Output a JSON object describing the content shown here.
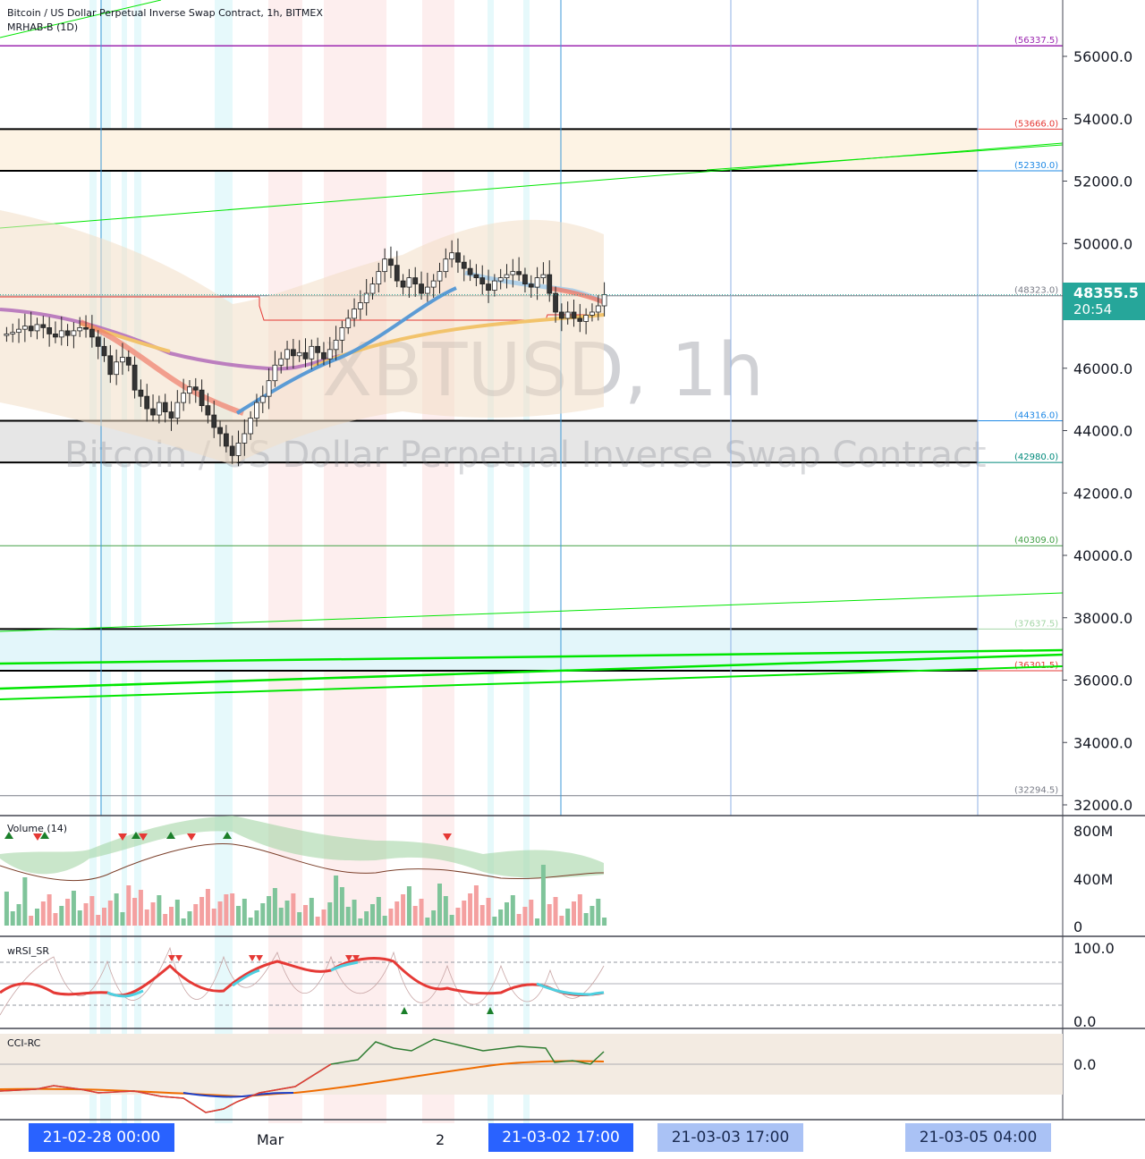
{
  "header": {
    "title": "Bitcoin / US Dollar Perpetual Inverse Swap Contract, 1h, BITMEX",
    "indicator": "MRHAB-B (1D)"
  },
  "watermark": {
    "symbol": "XBTUSD, 1h",
    "description": "Bitcoin / US Dollar Perpetual Inverse Swap Contract"
  },
  "last_price": {
    "value": "48355.5",
    "countdown": "20:54"
  },
  "panes": {
    "volume": {
      "label": "Volume (14)",
      "ticks": [
        "800M",
        "400M",
        "0"
      ]
    },
    "wrsi": {
      "label": "wRSI_SR",
      "ticks": [
        "100.0",
        "0.0"
      ]
    },
    "cci": {
      "label": "CCI-RC",
      "ticks": [
        "0.0"
      ]
    }
  },
  "time_axis": {
    "labels": [
      "Mar",
      "2"
    ],
    "tags": [
      {
        "text": "21-02-28   00:00",
        "style": "solid"
      },
      {
        "text": "21-03-02   17:00",
        "style": "solid"
      },
      {
        "text": "21-03-03   17:00",
        "style": "faint"
      },
      {
        "text": "21-03-05   04:00",
        "style": "faint"
      }
    ]
  },
  "colors": {
    "up": "#26a69a",
    "down": "#ef5350",
    "magenta_line": "#9c27b0",
    "green_line": "#00e600",
    "sr_red": "#e53935",
    "sr_blue": "#1e88e5",
    "sr_green": "#43a047",
    "volume_green": "#7fc49a",
    "volume_red": "#f4a0a0"
  },
  "chart_data": {
    "type": "candlestick",
    "price_axis": {
      "range": [
        31800,
        57700
      ],
      "ticks": [
        "56000.0",
        "54000.0",
        "52000.0",
        "50000.0",
        "46000.0",
        "44000.0",
        "42000.0",
        "40000.0",
        "38000.0",
        "36000.0",
        "34000.0",
        "32000.0"
      ]
    },
    "levels": [
      {
        "value": 56337.5,
        "label": "(56337.5)",
        "color": "#9c27b0"
      },
      {
        "value": 53666.0,
        "label": "(53666.0)",
        "color": "#e53935"
      },
      {
        "value": 52330.0,
        "label": "(52330.0)",
        "color": "#1e88e5"
      },
      {
        "value": 48323.0,
        "label": "(48323.0)",
        "color": "#787b86"
      },
      {
        "value": 44316.0,
        "label": "(44316.0)",
        "color": "#1e88e5"
      },
      {
        "value": 42980.0,
        "label": "(42980.0)",
        "color": "#00897b"
      },
      {
        "value": 40309.0,
        "label": "(40309.0)",
        "color": "#43a047"
      },
      {
        "value": 37637.5,
        "label": "(37637.5)",
        "color": "#a5d6a7"
      },
      {
        "value": 36301.5,
        "label": "(36301.5)",
        "color": "#e53935"
      },
      {
        "value": 32294.5,
        "label": "(32294.5)",
        "color": "#787b86"
      }
    ],
    "zones": [
      {
        "top": 53666.0,
        "bottom": 52330.0,
        "fill": "#fdf3e4"
      },
      {
        "top": 44316.0,
        "bottom": 42980.0,
        "fill": "#e6e6e6"
      },
      {
        "top": 37637.5,
        "bottom": 36301.5,
        "fill": "#e3f6fa"
      }
    ],
    "candles_close": [
      47100,
      47150,
      47250,
      47350,
      47200,
      47400,
      47300,
      47100,
      47000,
      47200,
      47050,
      47200,
      47300,
      47250,
      47000,
      46700,
      46400,
      45800,
      46200,
      46350,
      46100,
      45300,
      45100,
      44700,
      44500,
      44900,
      44600,
      44400,
      44900,
      45200,
      45400,
      45300,
      44800,
      44500,
      44100,
      43900,
      43500,
      43200,
      43600,
      43900,
      44400,
      44900,
      45100,
      45600,
      46100,
      46300,
      46600,
      46400,
      46500,
      46300,
      46700,
      46500,
      46300,
      46600,
      46900,
      47300,
      47600,
      47900,
      48100,
      48400,
      48700,
      49100,
      49500,
      49300,
      48800,
      48600,
      48900,
      48700,
      48400,
      48600,
      48800,
      49100,
      49500,
      49700,
      49400,
      49200,
      49000,
      48900,
      48700,
      48500,
      48800,
      48900,
      49000,
      49100,
      49000,
      48700,
      48600,
      48900,
      49000,
      48400,
      47800,
      47600,
      47800,
      47600,
      47500,
      47700,
      47800,
      48000,
      48355.5
    ]
  }
}
